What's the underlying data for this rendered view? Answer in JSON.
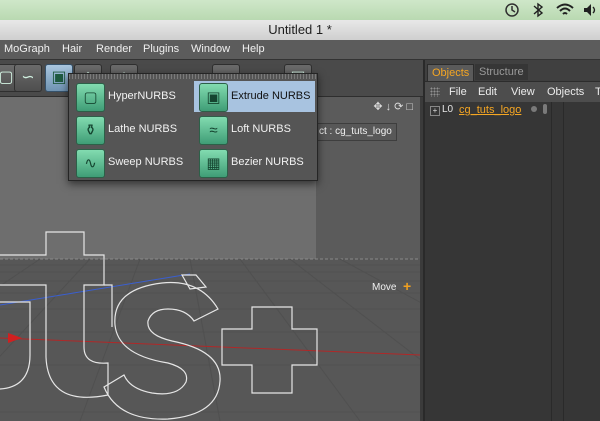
{
  "status_bar": {
    "icons": [
      "time-machine-icon",
      "bluetooth-icon",
      "wifi-icon",
      "volume-icon"
    ]
  },
  "window": {
    "title": "Untitled 1 *"
  },
  "menubar": {
    "items": [
      "MoGraph",
      "Hair",
      "Render",
      "Plugins",
      "Window",
      "Help"
    ]
  },
  "toolbar": {
    "buttons": [
      "cube-tool-icon",
      "spline-tool-icon",
      "nurbs-tool-icon",
      "deformer-tool-icon",
      "scene-tool-icon",
      "camera-tool-icon",
      "light-tool-icon",
      "render-tool-icon"
    ]
  },
  "nurbs_menu": {
    "items": [
      {
        "label": "HyperNURBS",
        "icon": "hypernurbs-icon",
        "highlighted": false
      },
      {
        "label": "Extrude NURBS",
        "icon": "extrude-nurbs-icon",
        "highlighted": true
      },
      {
        "label": "Lathe NURBS",
        "icon": "lathe-nurbs-icon",
        "highlighted": false
      },
      {
        "label": "Loft NURBS",
        "icon": "loft-nurbs-icon",
        "highlighted": false
      },
      {
        "label": "Sweep NURBS",
        "icon": "sweep-nurbs-icon",
        "highlighted": false
      },
      {
        "label": "Bezier NURBS",
        "icon": "bezier-nurbs-icon",
        "highlighted": false
      }
    ]
  },
  "viewport": {
    "object_label_prefix": "ct : ",
    "object_label_name": "cg_tuts_logo",
    "move_label": "Move",
    "move_symbol": "+",
    "text_shape": "tuts+"
  },
  "panel": {
    "tabs": [
      {
        "label": "Objects",
        "active": true
      },
      {
        "label": "Structure",
        "active": false
      }
    ],
    "menu": [
      "File",
      "Edit",
      "View",
      "Objects",
      "T"
    ],
    "objects": [
      {
        "name": "cg_tuts_logo",
        "icon": "null-object-icon"
      }
    ]
  },
  "colors": {
    "accent_orange": "#f5a623",
    "highlight_blue": "#a8c3e0",
    "nurbs_icon_green": "#5cc898"
  }
}
